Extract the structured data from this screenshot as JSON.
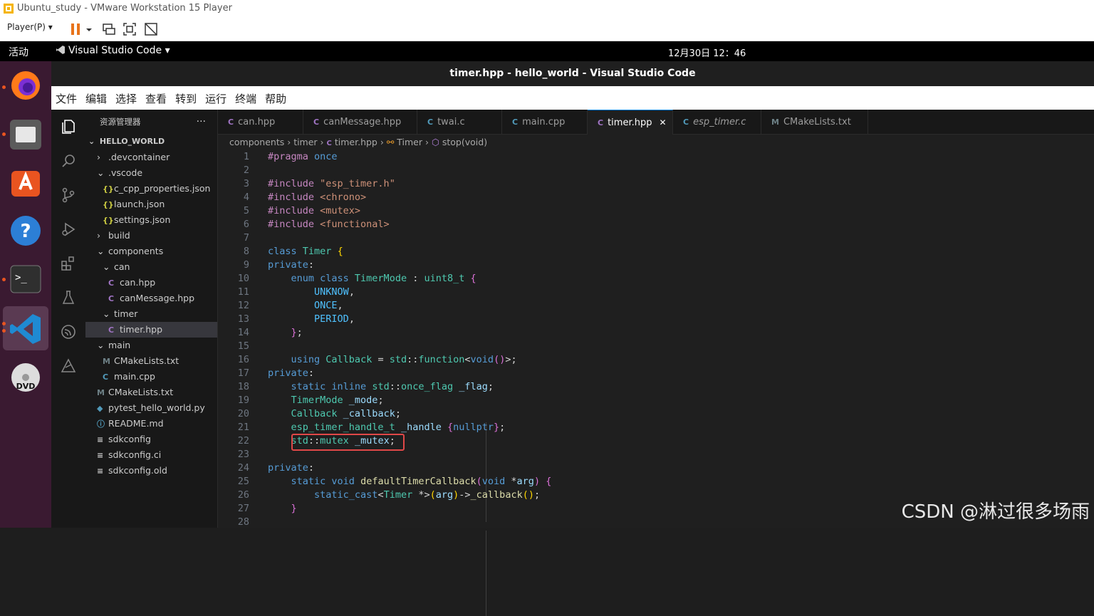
{
  "vm": {
    "title": "Ubuntu_study - VMware Workstation 15 Player",
    "player_menu": "Player(P)"
  },
  "topbar": {
    "activities": "活动",
    "app": "Visual Studio Code",
    "clock": "12月30日  12：46"
  },
  "vscode": {
    "title": "timer.hpp - hello_world - Visual Studio Code",
    "menu": [
      "文件",
      "编辑",
      "选择",
      "查看",
      "转到",
      "运行",
      "终端",
      "帮助"
    ],
    "explorer_title": "资源管理器",
    "explorer_more": "···",
    "tree": [
      {
        "label": "HELLO_WORLD",
        "chev": "⌄",
        "icon": "",
        "bold": true
      },
      {
        "label": ".devcontainer",
        "chev": "›",
        "icon": ""
      },
      {
        "label": ".vscode",
        "chev": "⌄",
        "icon": ""
      },
      {
        "label": "c_cpp_properties.json",
        "chev": "",
        "icon": "{}"
      },
      {
        "label": "launch.json",
        "chev": "",
        "icon": "{}"
      },
      {
        "label": "settings.json",
        "chev": "",
        "icon": "{}"
      },
      {
        "label": "build",
        "chev": "›",
        "icon": ""
      },
      {
        "label": "components",
        "chev": "⌄",
        "icon": ""
      },
      {
        "label": "can",
        "chev": "⌄",
        "icon": ""
      },
      {
        "label": "can.hpp",
        "chev": "",
        "icon": "C"
      },
      {
        "label": "canMessage.hpp",
        "chev": "",
        "icon": "C"
      },
      {
        "label": "timer",
        "chev": "⌄",
        "icon": ""
      },
      {
        "label": "timer.hpp",
        "chev": "",
        "icon": "C",
        "selected": true
      },
      {
        "label": "main",
        "chev": "⌄",
        "icon": ""
      },
      {
        "label": "CMakeLists.txt",
        "chev": "",
        "icon": "M"
      },
      {
        "label": "main.cpp",
        "chev": "",
        "icon": "C"
      },
      {
        "label": "CMakeLists.txt",
        "chev": "",
        "icon": "M"
      },
      {
        "label": "pytest_hello_world.py",
        "chev": "",
        "icon": "◆"
      },
      {
        "label": "README.md",
        "chev": "",
        "icon": "ⓘ"
      },
      {
        "label": "sdkconfig",
        "chev": "",
        "icon": "≡"
      },
      {
        "label": "sdkconfig.ci",
        "chev": "",
        "icon": "≡"
      },
      {
        "label": "sdkconfig.old",
        "chev": "",
        "icon": "≡"
      }
    ],
    "tabs": [
      {
        "label": "can.hpp",
        "icon": "C"
      },
      {
        "label": "canMessage.hpp",
        "icon": "C"
      },
      {
        "label": "twai.c",
        "icon": "C"
      },
      {
        "label": "main.cpp",
        "icon": "C"
      },
      {
        "label": "timer.hpp",
        "icon": "C",
        "active": true,
        "close": "✕"
      },
      {
        "label": "esp_timer.c",
        "icon": "C",
        "italic": true
      },
      {
        "label": "CMakeLists.txt",
        "icon": "M"
      }
    ],
    "breadcrumb": [
      "components",
      "timer",
      "timer.hpp",
      "Timer",
      "stop(void)"
    ],
    "line_numbers": [
      "1",
      "2",
      "3",
      "4",
      "5",
      "6",
      "7",
      "8",
      "9",
      "10",
      "11",
      "12",
      "13",
      "14",
      "15",
      "16",
      "17",
      "18",
      "19",
      "20",
      "21",
      "22",
      "23",
      "24",
      "25",
      "26",
      "27",
      "28"
    ]
  },
  "watermark": "CSDN @淋过很多场雨"
}
